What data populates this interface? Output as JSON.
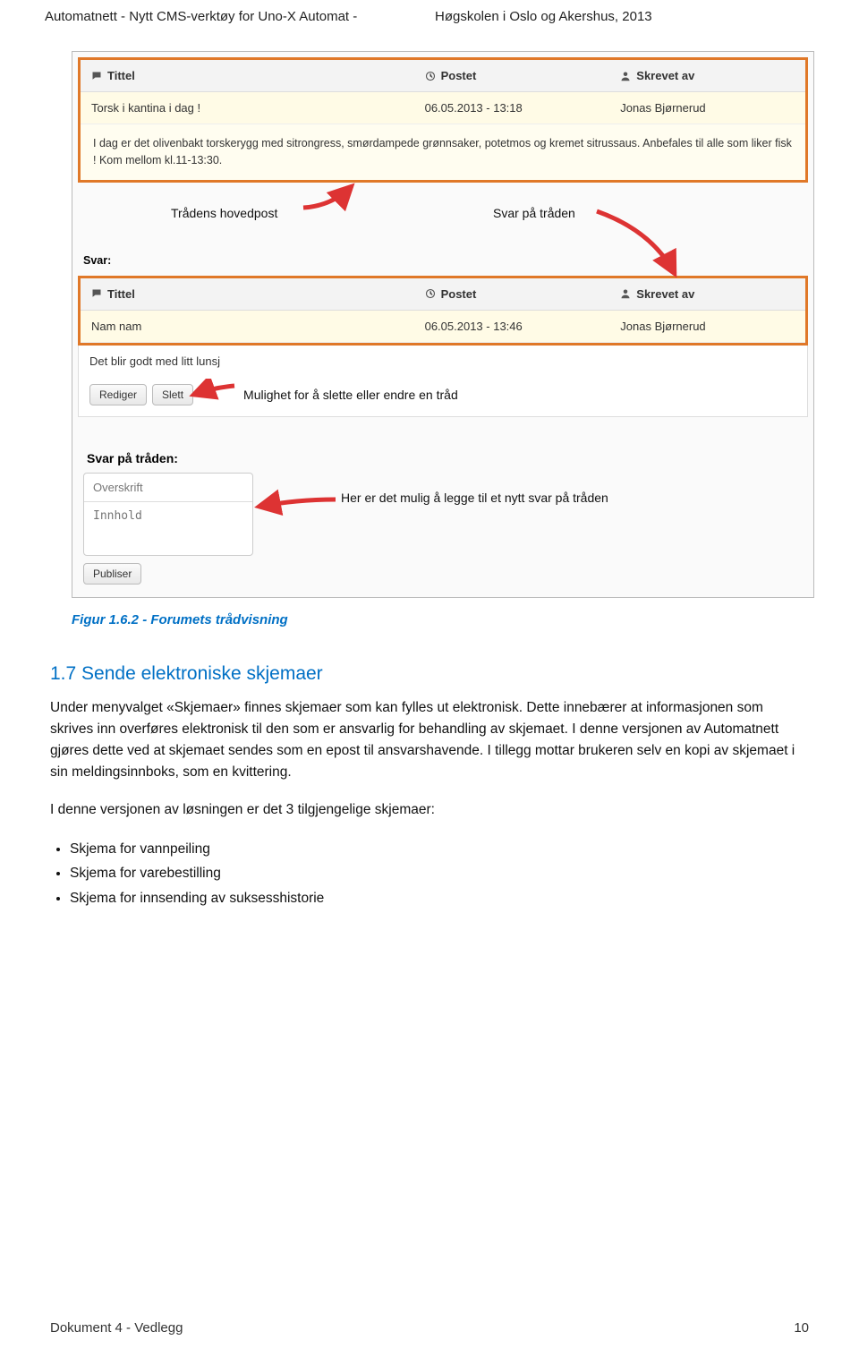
{
  "header": {
    "left": "Automatnett - Nytt CMS-verktøy for Uno-X Automat   -",
    "right": "Høgskolen i Oslo og Akershus, 2013"
  },
  "forumView": {
    "columns": {
      "title": "Tittel",
      "posted": "Postet",
      "author": "Skrevet av"
    },
    "mainPost": {
      "title": "Torsk i kantina i dag !",
      "posted": "06.05.2013 - 13:18",
      "author": "Jonas Bjørnerud",
      "body": "I dag er det olivenbakt torskerygg med sitrongress, smørdampede grønnsaker, potetmos og kremet sitrussaus. Anbefales til alle som liker fisk ! Kom mellom kl.11-13:30."
    },
    "annotations": {
      "hovedpost": "Trådens hovedpost",
      "svarPaa": "Svar på tråden",
      "svarLabel": "Svar:"
    },
    "replyPost": {
      "title": "Nam nam",
      "posted": "06.05.2013 - 13:46",
      "author": "Jonas Bjørnerud",
      "body": "Det blir godt med litt lunsj"
    },
    "buttons": {
      "rediger": "Rediger",
      "slett": "Slett",
      "anno": "Mulighet for å slette eller endre en tråd"
    },
    "replyForm": {
      "heading": "Svar på tråden:",
      "overskrift": "Overskrift",
      "innhold": "Innhold",
      "publiser": "Publiser",
      "anno": "Her er det mulig å legge til et nytt svar på tråden"
    }
  },
  "figureCaption": "Figur 1.6.2 - Forumets trådvisning",
  "section": {
    "heading": "1.7 Sende elektroniske skjemaer",
    "para1": "Under menyvalget «Skjemaer» finnes skjemaer som kan fylles ut elektronisk. Dette innebærer at informasjonen som skrives inn overføres elektronisk til den som er ansvarlig for behandling av skjemaet. I denne versjonen av Automatnett gjøres dette ved at skjemaet sendes som en epost til ansvarshavende. I tillegg mottar brukeren selv en kopi av skjemaet i sin meldingsinnboks, som en kvittering.",
    "para2": "I denne versjonen av løsningen er det 3 tilgjengelige skjemaer:",
    "bullets": [
      "Skjema for vannpeiling",
      "Skjema for varebestilling",
      "Skjema for innsending av suksesshistorie"
    ]
  },
  "footer": {
    "left": "Dokument 4 - Vedlegg",
    "right": "10"
  }
}
